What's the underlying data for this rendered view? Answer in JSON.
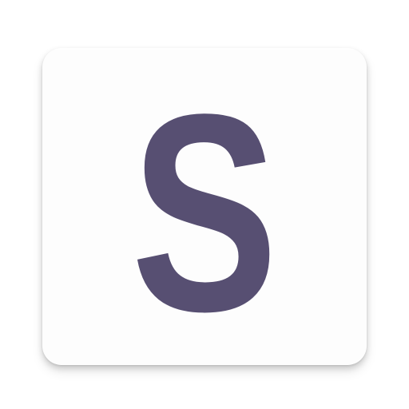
{
  "icon": {
    "letter": "S",
    "background_color": "#fdfdfd",
    "letter_color": "#574f72"
  }
}
